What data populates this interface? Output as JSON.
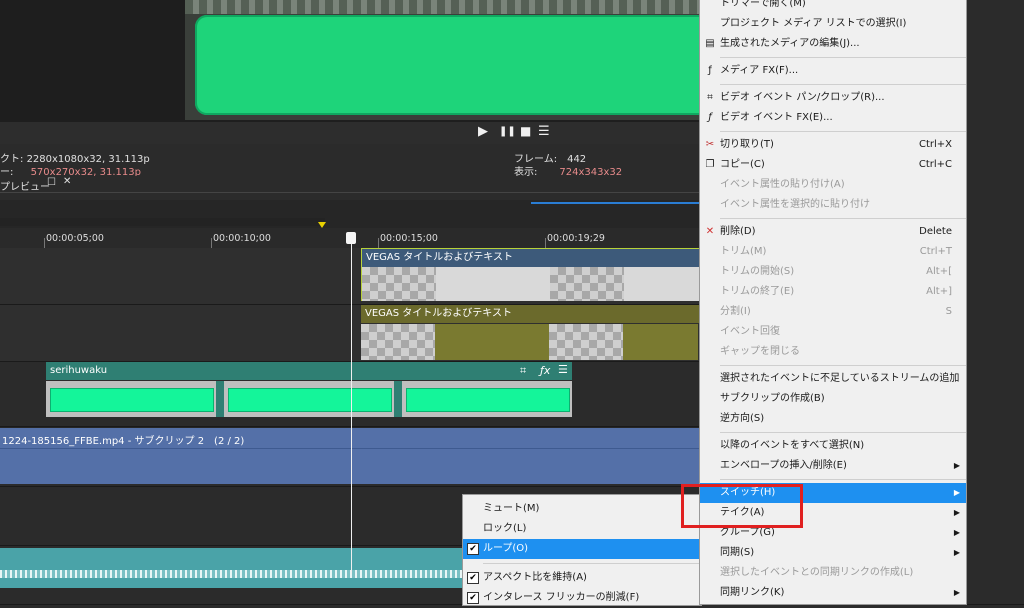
{
  "preview": {
    "res_label_1": "クト:",
    "res_value_1": "2280x1080x32, 31.113p",
    "res_label_2": "ー:",
    "res_value_2": "570x270x32, 31.113p",
    "frame_label": "フレーム:",
    "frame_value": "442",
    "display_label": "表示:",
    "display_value": "724x343x32",
    "tab_label": "プレビュー"
  },
  "transport": {
    "play": "▶",
    "pause": "❚❚",
    "stop": "■",
    "menu": "☰"
  },
  "ruler": {
    "ticks": [
      "00:00:05;00",
      "00:00:10;00",
      "00:00:15;00",
      "00:00:19;29"
    ]
  },
  "tracks": {
    "title_event_1": "VEGAS タイトルおよびテキスト",
    "title_event_2": "VEGAS タイトルおよびテキスト",
    "serihu_event": "serihuwaku",
    "video_event": "1224-185156_FFBE.mp4 - サブクリップ 2　(2 / 2)"
  },
  "main_menu": {
    "items": [
      {
        "label": "トリマーで開く(M)",
        "shortcut": "",
        "disabled": false
      },
      {
        "label": "プロジェクト メディア リストでの選択(I)",
        "shortcut": "",
        "disabled": false
      },
      {
        "label": "生成されたメディアの編集(J)...",
        "shortcut": "",
        "disabled": false
      },
      {
        "label": "メディア FX(F)...",
        "shortcut": "",
        "disabled": false
      },
      {
        "label": "ビデオ イベント パン/クロップ(R)...",
        "shortcut": "",
        "disabled": false
      },
      {
        "label": "ビデオ イベント FX(E)...",
        "shortcut": "",
        "disabled": false
      },
      {
        "label": "切り取り(T)",
        "shortcut": "Ctrl+X",
        "disabled": false
      },
      {
        "label": "コピー(C)",
        "shortcut": "Ctrl+C",
        "disabled": false
      },
      {
        "label": "イベント属性の貼り付け(A)",
        "shortcut": "",
        "disabled": true
      },
      {
        "label": "イベント属性を選択的に貼り付け",
        "shortcut": "",
        "disabled": true
      },
      {
        "label": "削除(D)",
        "shortcut": "Delete",
        "disabled": false
      },
      {
        "label": "トリム(M)",
        "shortcut": "Ctrl+T",
        "disabled": true
      },
      {
        "label": "トリムの開始(S)",
        "shortcut": "Alt+[",
        "disabled": true
      },
      {
        "label": "トリムの終了(E)",
        "shortcut": "Alt+]",
        "disabled": true
      },
      {
        "label": "分割(I)",
        "shortcut": "S",
        "disabled": true
      },
      {
        "label": "イベント回復",
        "shortcut": "",
        "disabled": true
      },
      {
        "label": "ギャップを閉じる",
        "shortcut": "",
        "disabled": true
      },
      {
        "label": "選択されたイベントに不足しているストリームの追加",
        "shortcut": "",
        "disabled": false
      },
      {
        "label": "サブクリップの作成(B)",
        "shortcut": "",
        "disabled": false
      },
      {
        "label": "逆方向(S)",
        "shortcut": "",
        "disabled": false
      },
      {
        "label": "以降のイベントをすべて選択(N)",
        "shortcut": "",
        "disabled": false
      },
      {
        "label": "エンベロープの挿入/削除(E)",
        "shortcut": "",
        "disabled": false
      },
      {
        "label": "スイッチ(H)",
        "shortcut": "",
        "disabled": false
      },
      {
        "label": "テイク(A)",
        "shortcut": "",
        "disabled": false
      },
      {
        "label": "グループ(G)",
        "shortcut": "",
        "disabled": false
      },
      {
        "label": "同期(S)",
        "shortcut": "",
        "disabled": false
      },
      {
        "label": "選択したイベントとの同期リンクの作成(L)",
        "shortcut": "",
        "disabled": true
      },
      {
        "label": "同期リンク(K)",
        "shortcut": "",
        "disabled": false
      }
    ]
  },
  "sub_menu": {
    "items": [
      {
        "label": "ミュート(M)",
        "checked": false
      },
      {
        "label": "ロック(L)",
        "checked": false
      },
      {
        "label": "ループ(O)",
        "checked": true
      },
      {
        "label": "アスペクト比を維持(A)",
        "checked": true
      },
      {
        "label": "インタレース フリッカーの削減(F)",
        "checked": true
      }
    ]
  },
  "colors": {
    "menu_highlight": "#1e90f0",
    "annotation_box": "#e02020",
    "green_clip": "#14f59a"
  }
}
